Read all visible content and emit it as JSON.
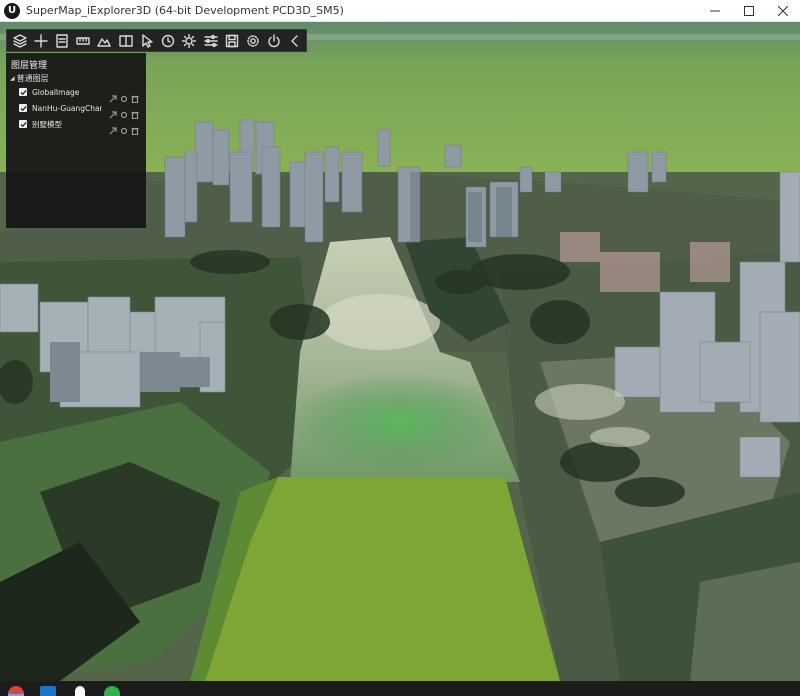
{
  "window": {
    "title": "SuperMap_iExplorer3D (64-bit Development PCD3D_SM5)",
    "logo_letter": "U",
    "controls": {
      "minimize": "—",
      "maximize": "☐",
      "close": "✕"
    }
  },
  "toolbar": {
    "tools": [
      "layers-icon",
      "add-icon",
      "document-icon",
      "ruler-icon",
      "terrain-icon",
      "book-icon",
      "cursor-icon",
      "clock-icon",
      "sun-icon",
      "sliders-icon",
      "save-icon",
      "settings-icon",
      "power-icon",
      "collapse-chevron-icon"
    ]
  },
  "layer_panel": {
    "title": "图层管理",
    "group": "普通图层",
    "layers": [
      {
        "name": "GlobalImage",
        "checked": true
      },
      {
        "name": "NanHu-GuangChan",
        "checked": true
      },
      {
        "name": "别墅模型",
        "checked": true
      }
    ]
  },
  "taskbar": {
    "apps": [
      {
        "icon": "chrome-icon",
        "color": "#d9473b",
        "active": true
      },
      {
        "icon": "cnki-icon",
        "color": "#1f74c9",
        "active": false
      },
      {
        "icon": "unreal-icon",
        "color": "#ffffff",
        "active": false
      },
      {
        "icon": "wechat-icon",
        "color": "#2fb24c",
        "active": false
      }
    ]
  },
  "colors": {
    "sky": "#83ad5a",
    "ground_green": "#7ea634",
    "panel_bg": "#161616",
    "toolbar_bg": "#232323"
  }
}
